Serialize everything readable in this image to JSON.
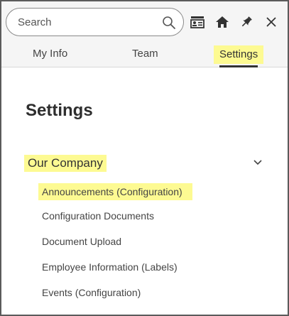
{
  "search": {
    "placeholder": "Search",
    "icon": "search-icon"
  },
  "toolbar": {
    "icons": [
      "profile-card-icon",
      "home-icon",
      "pin-icon",
      "close-icon"
    ]
  },
  "tabs": [
    {
      "label": "My Info",
      "active": false
    },
    {
      "label": "Team",
      "active": false
    },
    {
      "label": "Settings",
      "active": true
    }
  ],
  "content": {
    "title": "Settings",
    "section": {
      "label": "Our Company",
      "expanded": true,
      "items": [
        {
          "label": "Announcements (Configuration)",
          "highlighted": true
        },
        {
          "label": "Configuration Documents",
          "highlighted": false
        },
        {
          "label": "Document Upload",
          "highlighted": false
        },
        {
          "label": "Employee Information (Labels)",
          "highlighted": false
        },
        {
          "label": "Events (Configuration)",
          "highlighted": false
        }
      ]
    }
  },
  "colors": {
    "highlight": "#fdfa92",
    "header_bg": "#f5f5f5",
    "border": "#5b5b5b",
    "text": "#333333"
  }
}
